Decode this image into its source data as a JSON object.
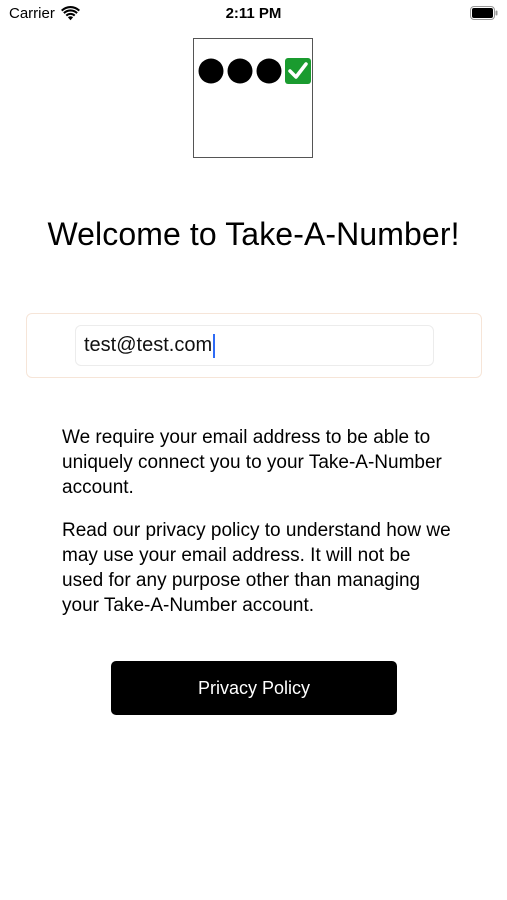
{
  "status_bar": {
    "carrier": "Carrier",
    "time": "2:11 PM",
    "wifi_icon": "wifi-icon",
    "battery_icon": "battery-icon"
  },
  "logo": {
    "icon": "take-a-number-logo",
    "check_color": "#1a9b2f"
  },
  "title": "Welcome to Take-A-Number!",
  "email": {
    "value": "test@test.com",
    "caret_color": "#2f6bf5"
  },
  "paragraphs": {
    "requirement": "We require your email address to be able to uniquely connect you to your Take-A-Number account.",
    "privacy": "Read our privacy policy to understand how we may use your email address. It will not be used for any purpose other than managing your Take-A-Number account."
  },
  "privacy_button": {
    "label": "Privacy Policy"
  }
}
